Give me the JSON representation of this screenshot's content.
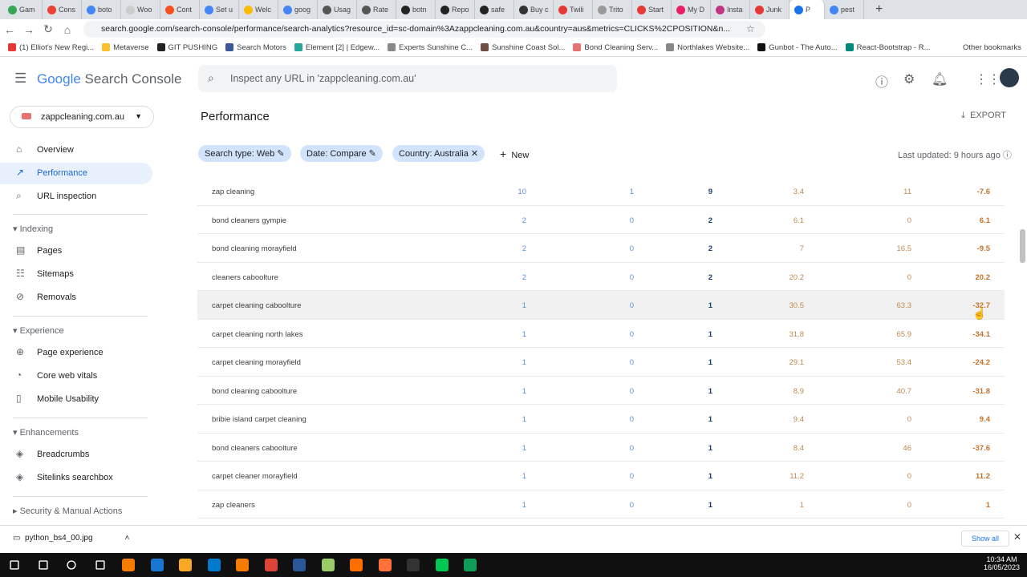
{
  "browser": {
    "tabs": [
      "Gam",
      "Cons",
      "boto",
      "Woo",
      "Cont",
      "Set u",
      "Welc",
      "goog",
      "Usag",
      "Rate",
      "botn",
      "Repo",
      "safe",
      "Buy c",
      "Twili",
      "Trito",
      "Start",
      "My D",
      "Insta",
      "Junk",
      "P",
      "pest"
    ],
    "active_tab_index": 20,
    "url": "search.google.com/search-console/performance/search-analytics?resource_id=sc-domain%3Azappcleaning.com.au&country=aus&metrics=CLICKS%2CPOSITION&n...",
    "bookmarks": [
      "(1) Elliot's New Regi...",
      "Metaverse",
      "GIT PUSHING",
      "Search Motors",
      "Element [2] | Edgew...",
      "Experts Sunshine C...",
      "Sunshine Coast Sol...",
      "Bond Cleaning Serv...",
      "Northlakes Website...",
      "Gunbot - The Auto...",
      "React-Bootstrap - R..."
    ],
    "other_bookmarks": "Other bookmarks"
  },
  "header": {
    "logo_google": "Google",
    "logo_product": " Search Console",
    "search_placeholder": "Inspect any URL in 'zappcleaning.com.au'"
  },
  "sidebar": {
    "property": "zappcleaning.com.au",
    "overview": "Overview",
    "performance": "Performance",
    "url_inspection": "URL inspection",
    "indexing": "Indexing",
    "pages": "Pages",
    "sitemaps": "Sitemaps",
    "removals": "Removals",
    "experience": "Experience",
    "page_experience": "Page experience",
    "core_web_vitals": "Core web vitals",
    "mobile_usability": "Mobile Usability",
    "enhancements": "Enhancements",
    "breadcrumbs": "Breadcrumbs",
    "sitelinks": "Sitelinks searchbox",
    "security": "Security & Manual Actions"
  },
  "main": {
    "title": "Performance",
    "export": "EXPORT",
    "filters": [
      "Search type: Web",
      "Date: Compare",
      "Country: Australia"
    ],
    "new": "New",
    "last_updated": "Last updated: 9 hours ago",
    "rows": [
      [
        "zap cleaning",
        "10",
        "1",
        "9",
        "3.4",
        "11",
        "-7.6"
      ],
      [
        "bond cleaners gympie",
        "2",
        "0",
        "2",
        "6.1",
        "0",
        "6.1"
      ],
      [
        "bond cleaning morayfield",
        "2",
        "0",
        "2",
        "7",
        "16.5",
        "-9.5"
      ],
      [
        "cleaners caboolture",
        "2",
        "0",
        "2",
        "20.2",
        "0",
        "20.2"
      ],
      [
        "carpet cleaning caboolture",
        "1",
        "0",
        "1",
        "30.5",
        "63.3",
        "-32.7"
      ],
      [
        "carpet cleaning north lakes",
        "1",
        "0",
        "1",
        "31.8",
        "65.9",
        "-34.1"
      ],
      [
        "carpet cleaning morayfield",
        "1",
        "0",
        "1",
        "29.1",
        "53.4",
        "-24.2"
      ],
      [
        "bond cleaning caboolture",
        "1",
        "0",
        "1",
        "8.9",
        "40.7",
        "-31.8"
      ],
      [
        "bribie island carpet cleaning",
        "1",
        "0",
        "1",
        "9.4",
        "0",
        "9.4"
      ],
      [
        "bond cleaners caboolture",
        "1",
        "0",
        "1",
        "8.4",
        "46",
        "-37.6"
      ],
      [
        "carpet cleaner morayfield",
        "1",
        "0",
        "1",
        "11.2",
        "0",
        "11.2"
      ],
      [
        "zap cleaners",
        "1",
        "0",
        "1",
        "1",
        "0",
        "1"
      ]
    ]
  },
  "download": {
    "file": "python_bs4_00.jpg",
    "show_all": "Show all"
  },
  "taskbar": {
    "time": "10:34 AM",
    "date": "16/05/2023"
  }
}
